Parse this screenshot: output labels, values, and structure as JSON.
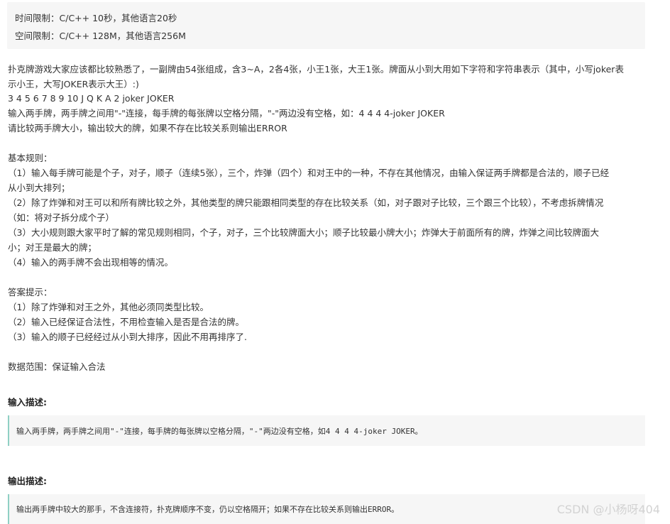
{
  "limits": {
    "time": "时间限制：C/C++ 10秒，其他语言20秒",
    "space": "空间限制：C/C++ 128M，其他语言256M"
  },
  "description": {
    "p1_line1": "扑克牌游戏大家应该都比较熟悉了，一副牌由54张组成，含3~A，2各4张，小王1张，大王1张。牌面从小到大用如下字符和字符串表示（其中，小写joker表",
    "p1_line2": "示小王，大写JOKER表示大王）:)",
    "cards": "3 4 5 6 7 8 9 10 J Q K A 2 joker JOKER",
    "input_rule": "输入两手牌，两手牌之间用\"-\"连接，每手牌的每张牌以空格分隔，\"-\"两边没有空格，如：4 4 4 4-joker JOKER",
    "compare_rule": "请比较两手牌大小，输出较大的牌，如果不存在比较关系则输出ERROR"
  },
  "basic_rules": {
    "title": "基本规则：",
    "r1_line1": "（1）输入每手牌可能是个子，对子，顺子（连续5张），三个，炸弹（四个）和对王中的一种，不存在其他情况，由输入保证两手牌都是合法的，顺子已经",
    "r1_line2": "从小到大排列；",
    "r2_line1": "（2）除了炸弹和对王可以和所有牌比较之外，其他类型的牌只能跟相同类型的存在比较关系（如，对子跟对子比较，三个跟三个比较），不考虑拆牌情况",
    "r2_line2": "（如：将对子拆分成个子）",
    "r3_line1": "（3）大小规则跟大家平时了解的常见规则相同，个子，对子，三个比较牌面大小；顺子比较最小牌大小；炸弹大于前面所有的牌，炸弹之间比较牌面大",
    "r3_line2": "小；对王是最大的牌；",
    "r4": "（4）输入的两手牌不会出现相等的情况。"
  },
  "hints": {
    "title": "答案提示：",
    "h1": "（1）除了炸弹和对王之外，其他必须同类型比较。",
    "h2": "（2）输入已经保证合法性，不用检查输入是否是合法的牌。",
    "h3": "（3）输入的顺子已经经过从小到大排序，因此不用再排序了."
  },
  "data_range": "数据范围：保证输入合法",
  "input_section": {
    "heading": "输入描述:",
    "content": "输入两手牌，两手牌之间用\"-\"连接，每手牌的每张牌以空格分隔，\"-\"两边没有空格，如4 4 4 4-joker JOKER。"
  },
  "output_section": {
    "heading": "输出描述:",
    "content": "输出两手牌中较大的那手，不含连接符，扑克牌顺序不变，仍以空格隔开；如果不存在比较关系则输出ERROR。"
  },
  "watermark": "CSDN @小杨呀404"
}
